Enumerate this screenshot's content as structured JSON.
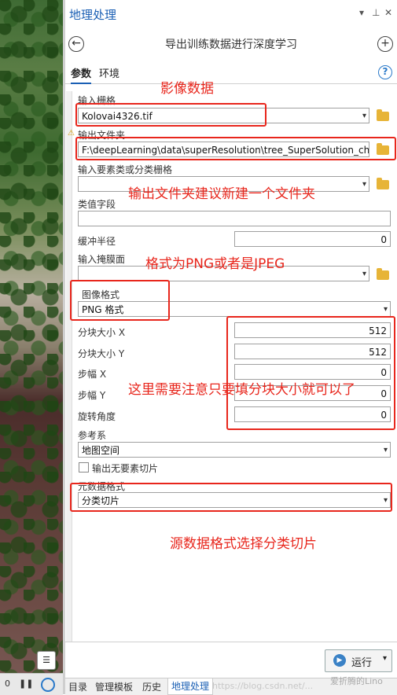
{
  "pane": {
    "title": "地理处理",
    "controls": [
      "▾",
      "⊥",
      "✕"
    ],
    "tool_title": "导出训练数据进行深度学习",
    "tabs": [
      "参数",
      "环境"
    ]
  },
  "fields": {
    "input_raster_label": "输入栅格",
    "input_raster_value": "Kolovai4326.tif",
    "output_folder_label": "输出文件夹",
    "output_folder_value": "F:\\deepLearning\\data\\superResolution\\tree_SuperSolution_chip",
    "feature_class_label": "输入要素类或分类栅格",
    "value_field_label": "类值字段",
    "buffer_label": "缓冲半径",
    "buffer_value": "0",
    "mask_label": "输入掩膜面",
    "image_format_label": "图像格式",
    "image_format_value": "PNG 格式",
    "tile_x_label": "分块大小 X",
    "tile_x_value": "512",
    "tile_y_label": "分块大小 Y",
    "tile_y_value": "512",
    "stride_x_label": "步幅 X",
    "stride_x_value": "0",
    "stride_y_label": "步幅 Y",
    "stride_y_value": "0",
    "rotation_label": "旋转角度",
    "rotation_value": "0",
    "ref_label": "参考系",
    "ref_value": "地图空间",
    "no_feature_label": "输出无要素切片",
    "meta_label": "元数据格式",
    "meta_value": "分类切片"
  },
  "footer": {
    "run_label": "运行"
  },
  "bottom_tabs": [
    "目录",
    "管理模板",
    "历史",
    "地理处理"
  ],
  "map_toolbar": {
    "scale": "0",
    "pause": "❚❚"
  },
  "annotations": {
    "a1": "影像数据",
    "a2": "输出文件夹建议新建一个文件夹",
    "a3": "格式为PNG或者是JPEG",
    "a4": "这里需要注意只要填分块大小就可以了",
    "a5": "源数据格式选择分类切片"
  },
  "watermark": {
    "url": "https://blog.csdn.net/...",
    "author": "爱折腾的Lino"
  },
  "colors": {
    "accent": "#1a5fb4",
    "annotation": "#e8261c",
    "folder": "#e7b437"
  }
}
